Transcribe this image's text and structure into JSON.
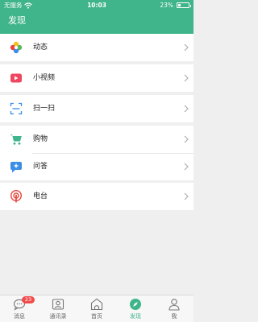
{
  "status_bar": {
    "carrier": "无服务",
    "time": "10:03",
    "battery": "23%",
    "battery_level": 0.23
  },
  "header": {
    "title": "发现"
  },
  "groups": [
    {
      "items": [
        {
          "label": "动态",
          "icon": "photo-wheel-icon"
        }
      ]
    },
    {
      "items": [
        {
          "label": "小视频",
          "icon": "video-camera-icon"
        }
      ]
    },
    {
      "items": [
        {
          "label": "扫一扫",
          "icon": "scan-icon"
        }
      ]
    },
    {
      "items": [
        {
          "label": "购物",
          "icon": "shopping-cart-icon"
        },
        {
          "label": "问答",
          "icon": "qa-chat-icon"
        }
      ]
    },
    {
      "items": [
        {
          "label": "电台",
          "icon": "radio-icon"
        }
      ]
    }
  ],
  "tabbar": {
    "tabs": [
      {
        "label": "消息",
        "icon": "message-bubble-icon",
        "badge": "23"
      },
      {
        "label": "通讯录",
        "icon": "contacts-icon"
      },
      {
        "label": "首页",
        "icon": "home-icon"
      },
      {
        "label": "发现",
        "icon": "discover-compass-icon",
        "active": true
      },
      {
        "label": "我",
        "icon": "profile-person-icon"
      }
    ]
  },
  "colors": {
    "accent": "#40b48a",
    "badge": "#f24b4b",
    "background": "#efefef"
  }
}
